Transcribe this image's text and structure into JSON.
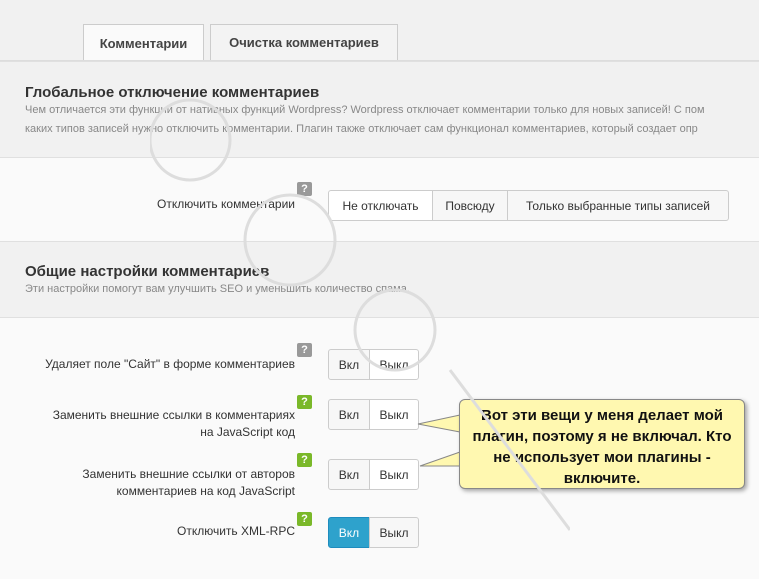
{
  "tabs": [
    {
      "label": "Комментарии",
      "active": true
    },
    {
      "label": "Очистка комментариев",
      "active": false
    }
  ],
  "global_section": {
    "title": "Глобальное отключение комментариев",
    "desc_line1": "Чем отличается эти функции от нативных функций Wordpress? Wordpress отключает комментарии только для новых записей! С пом",
    "desc_line2": "каких типов записей нужно отключить комментарии. Плагин также отключает сам функционал комментариев, который создает опр"
  },
  "disable_comments": {
    "label": "Отключить комментарии",
    "help": "?",
    "options": [
      "Не отключать",
      "Повсюду",
      "Только выбранные типы записей"
    ],
    "selected": "Не отключать"
  },
  "general_section": {
    "title": "Общие настройки комментариев",
    "desc": "Эти настройки помогут вам улучшить SEO и уменьшить количество спама."
  },
  "settings": [
    {
      "label_line1": "Удаляет поле \"Сайт\" в форме комментариев",
      "label_line2": "",
      "help": "?",
      "on": "Вкл",
      "off": "Выкл",
      "selected": "Выкл"
    },
    {
      "label_line1": "Заменить внешние ссылки в комментариях",
      "label_line2": "на JavaScript код",
      "help": "?",
      "on": "Вкл",
      "off": "Выкл",
      "selected": "Выкл"
    },
    {
      "label_line1": "Заменить внешние ссылки от авторов",
      "label_line2": "комментариев на код JavaScript",
      "help": "?",
      "on": "Вкл",
      "off": "Выкл",
      "selected": "Выкл"
    },
    {
      "label_line1": "Отключить XML-RPC",
      "label_line2": "",
      "help": "?",
      "on": "Вкл",
      "off": "Выкл",
      "selected": "Вкл"
    }
  ],
  "callout": {
    "text": "Вот эти вещи у меня делает мой плагин, поэтому я не включал. Кто не использует мои плагины - включите."
  },
  "colors": {
    "accent": "#2ea2cc",
    "help_green": "#7ab829",
    "help_gray": "#999999",
    "callout_bg": "#fff8b0"
  }
}
